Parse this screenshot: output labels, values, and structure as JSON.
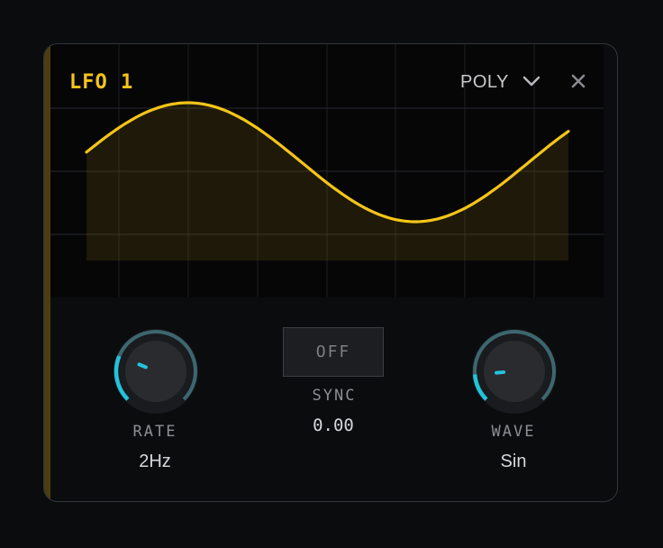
{
  "lfo": {
    "title": "LFO 1",
    "mode": "POLY",
    "icons": {
      "mode_dropdown": "chevron-down-icon",
      "close": "close-icon"
    },
    "waveform": "sine",
    "rate": {
      "label": "RATE",
      "value": "2Hz",
      "level": 0.25
    },
    "sync": {
      "button": "OFF",
      "label": "SYNC",
      "value": "0.00"
    },
    "wave": {
      "label": "WAVE",
      "value": "Sin",
      "level": 0.15
    }
  },
  "colors": {
    "accent": "#f5c518",
    "knob_ring": "#22c3dc",
    "knob_track": "#3d6770",
    "background": "#0b0c0e"
  }
}
